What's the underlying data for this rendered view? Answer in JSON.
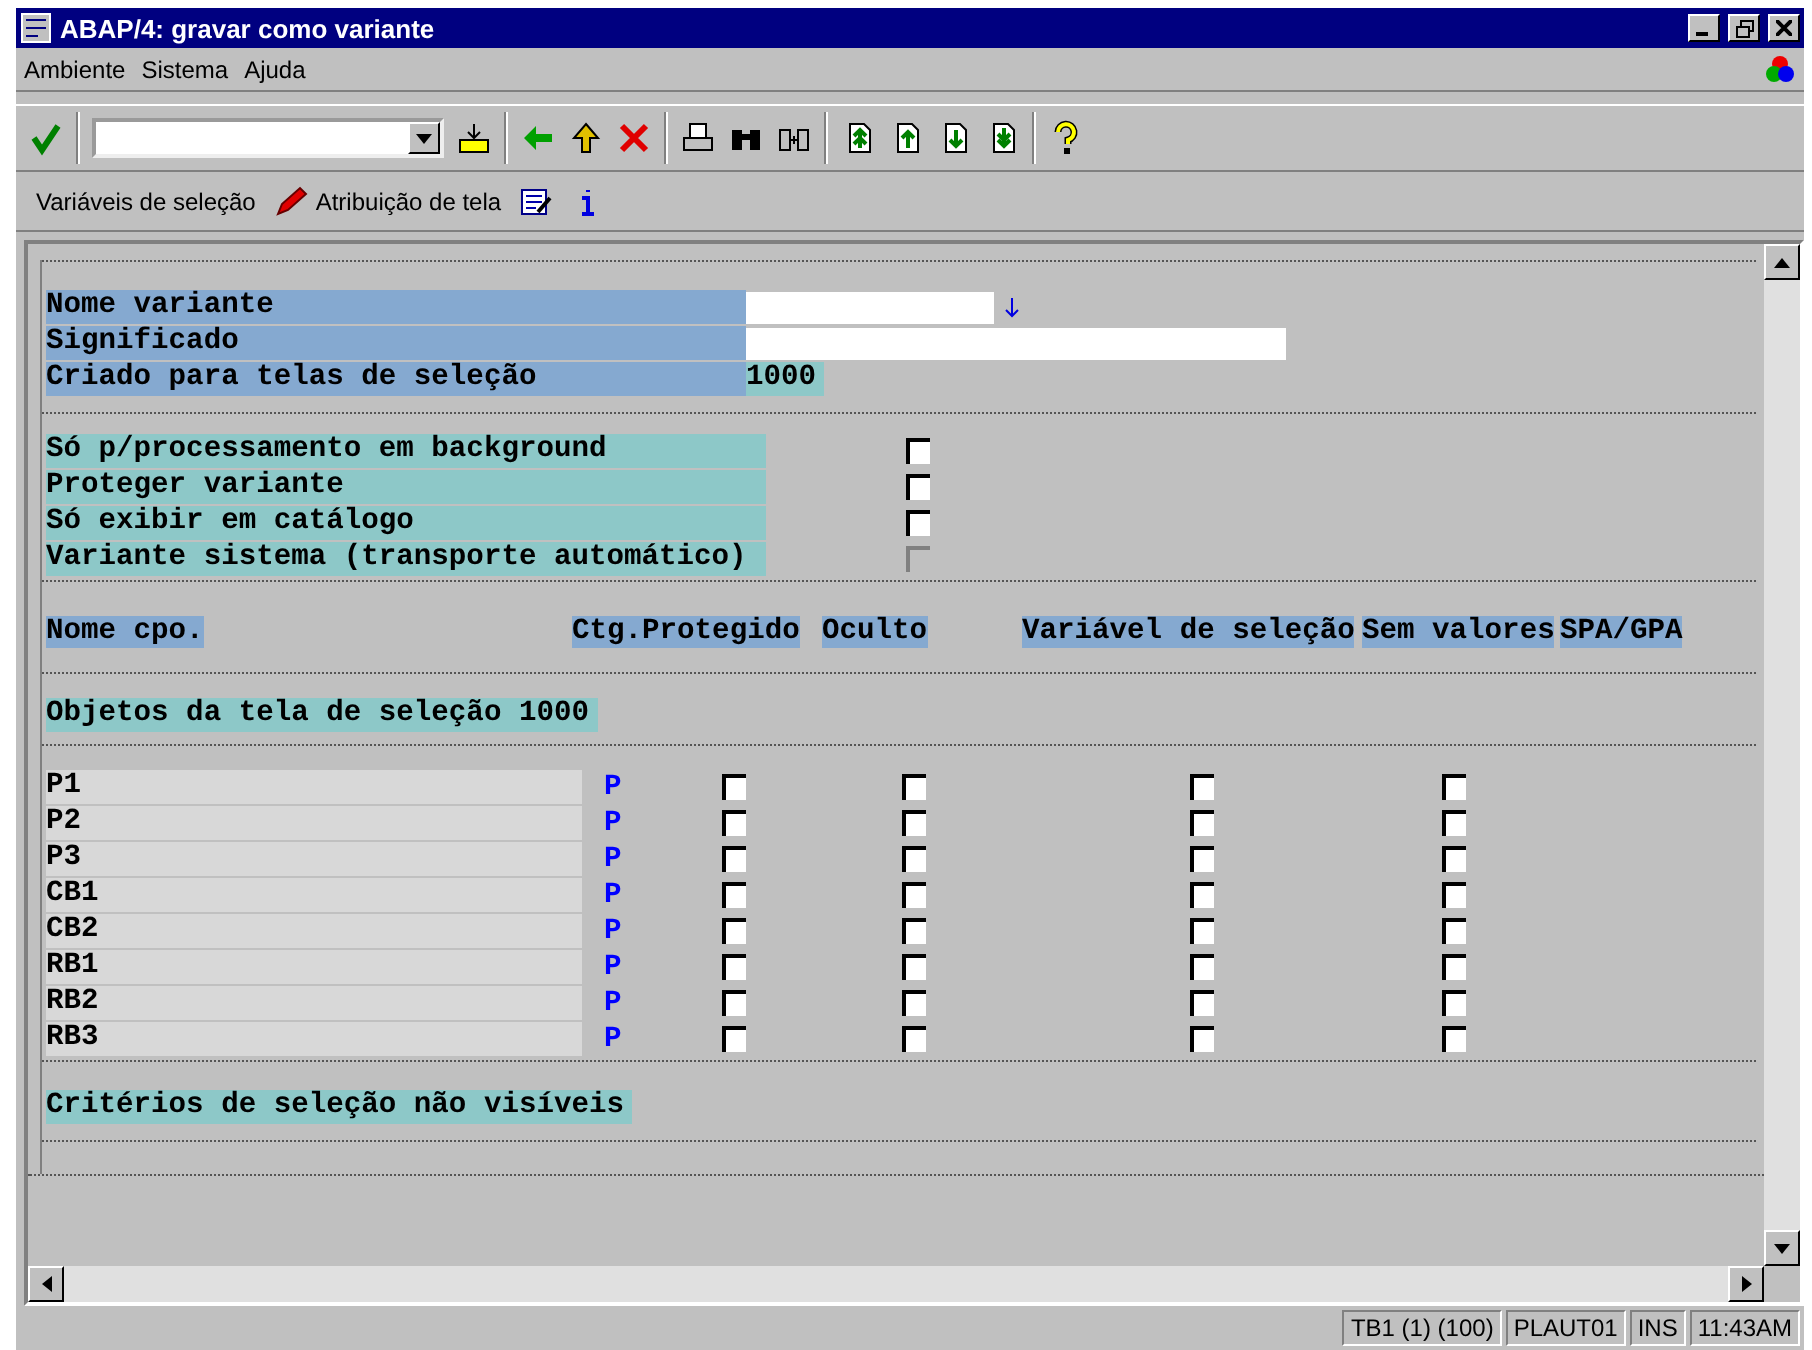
{
  "window": {
    "title": "ABAP/4: gravar como variante"
  },
  "menu": [
    {
      "label": "Ambiente"
    },
    {
      "label": "Sistema"
    },
    {
      "label": "Ajuda"
    }
  ],
  "app_toolbar": [
    {
      "kind": "text",
      "label": "Variáveis de seleção"
    },
    {
      "kind": "pencil",
      "label": "Atribuição de tela"
    }
  ],
  "variant": [
    {
      "kind": "input-help",
      "label": "Nome variante"
    },
    {
      "kind": "input",
      "label": "Significado"
    },
    {
      "kind": "value",
      "label": "Criado para telas de seleção",
      "value": "1000"
    }
  ],
  "attributes": [
    {
      "label": "Só p/processamento em background",
      "checked": false,
      "disabled": false
    },
    {
      "label": "Proteger variante",
      "checked": false,
      "disabled": false
    },
    {
      "label": "Só exibir em catálogo",
      "checked": false,
      "disabled": false
    },
    {
      "label": "Variante sistema (transporte automático)",
      "checked": false,
      "disabled": true
    }
  ],
  "table": {
    "columns": [
      "Nome cpo.",
      "Ctg.Protegido",
      "Oculto",
      "Variável de seleção",
      "Sem valores",
      "SPA/GPA"
    ],
    "section_title": "Objetos da tela de seleção 1000",
    "rows": [
      {
        "name": "P1",
        "type": "P",
        "protected": false,
        "hidden": false,
        "selection_variable": false,
        "no_values": false
      },
      {
        "name": "P2",
        "type": "P",
        "protected": false,
        "hidden": false,
        "selection_variable": false,
        "no_values": false
      },
      {
        "name": "P3",
        "type": "P",
        "protected": false,
        "hidden": false,
        "selection_variable": false,
        "no_values": false
      },
      {
        "name": "CB1",
        "type": "P",
        "protected": false,
        "hidden": false,
        "selection_variable": false,
        "no_values": false
      },
      {
        "name": "CB2",
        "type": "P",
        "protected": false,
        "hidden": false,
        "selection_variable": false,
        "no_values": false
      },
      {
        "name": "RB1",
        "type": "P",
        "protected": false,
        "hidden": false,
        "selection_variable": false,
        "no_values": false
      },
      {
        "name": "RB2",
        "type": "P",
        "protected": false,
        "hidden": false,
        "selection_variable": false,
        "no_values": false
      },
      {
        "name": "RB3",
        "type": "P",
        "protected": false,
        "hidden": false,
        "selection_variable": false,
        "no_values": false
      }
    ],
    "footer_title": "Critérios de seleção não visíveis"
  },
  "status_bar": [
    "TB1 (1) (100)",
    "PLAUT01",
    "INS",
    "11:43AM"
  ]
}
